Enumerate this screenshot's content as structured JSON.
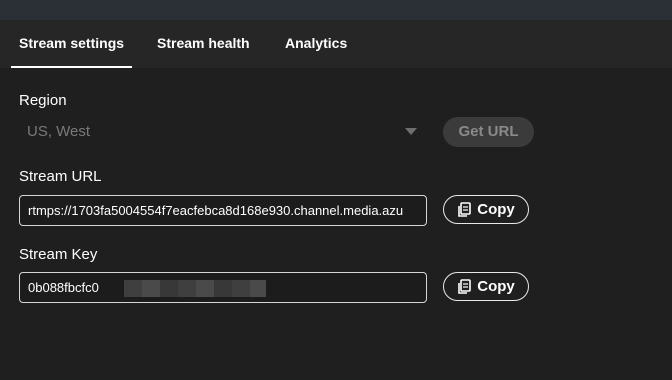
{
  "tabs": [
    {
      "label": "Stream settings",
      "active": true
    },
    {
      "label": "Stream health",
      "active": false
    },
    {
      "label": "Analytics",
      "active": false
    }
  ],
  "region": {
    "label": "Region",
    "selected": "US, West",
    "get_url_label": "Get URL"
  },
  "stream_url": {
    "label": "Stream URL",
    "value": "rtmps://1703fa5004554f7eacfebca8d168e930.channel.media.azu",
    "copy_label": "Copy"
  },
  "stream_key": {
    "label": "Stream Key",
    "value": "0b088fbcfc0",
    "copy_label": "Copy"
  },
  "icons": {
    "copy": "copy-icon",
    "dropdown": "chevron-down-icon"
  }
}
